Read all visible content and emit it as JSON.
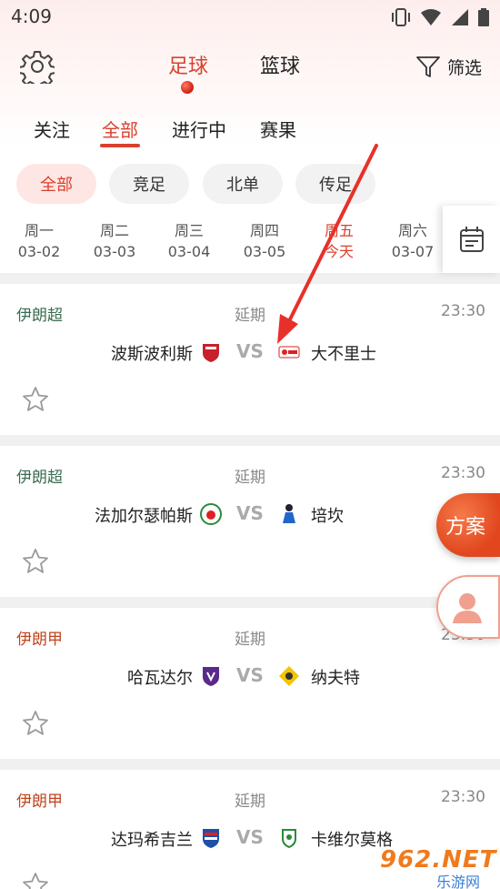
{
  "status_bar": {
    "time": "4:09"
  },
  "sport_tabs": [
    {
      "label": "足球",
      "active": true
    },
    {
      "label": "篮球",
      "active": false
    }
  ],
  "filter": {
    "label": "筛选"
  },
  "sub_tabs": [
    {
      "label": "关注"
    },
    {
      "label": "全部",
      "active": true
    },
    {
      "label": "进行中"
    },
    {
      "label": "赛果"
    }
  ],
  "chips": [
    {
      "label": "全部",
      "active": true
    },
    {
      "label": "竞足"
    },
    {
      "label": "北单"
    },
    {
      "label": "传足"
    }
  ],
  "days": [
    {
      "weekday": "周一",
      "date": "03-02"
    },
    {
      "weekday": "周二",
      "date": "03-03"
    },
    {
      "weekday": "周三",
      "date": "03-04"
    },
    {
      "weekday": "周四",
      "date": "03-05"
    },
    {
      "weekday": "周五",
      "date": "今天",
      "active": true
    },
    {
      "weekday": "周六",
      "date": "03-07"
    }
  ],
  "matches": [
    {
      "league": "伊朗超",
      "league_color": "#3b6b50",
      "status": "延期",
      "time": "23:30",
      "home": "波斯波利斯",
      "vs": "VS",
      "away": "大不里士"
    },
    {
      "league": "伊朗超",
      "league_color": "#3b6b50",
      "status": "延期",
      "time": "23:30",
      "home": "法加尔瑟帕斯",
      "vs": "VS",
      "away": "培坎"
    },
    {
      "league": "伊朗甲",
      "league_color": "#c0441e",
      "status": "延期",
      "time": "23:30",
      "home": "哈瓦达尔",
      "vs": "VS",
      "away": "纳夫特"
    },
    {
      "league": "伊朗甲",
      "league_color": "#c0441e",
      "status": "延期",
      "time": "23:30",
      "home": "达玛希吉兰",
      "vs": "VS",
      "away": "卡维尔莫格"
    }
  ],
  "fab": {
    "plan_label": "方案"
  },
  "watermark": {
    "number": "962.NET",
    "sub": "乐游网"
  },
  "colors": {
    "accent": "#d9412e",
    "arrow": "#e8302a"
  },
  "icons": [
    "gear-icon",
    "filter-icon",
    "calendar-icon",
    "star-icon",
    "user-icon",
    "team-logo"
  ]
}
